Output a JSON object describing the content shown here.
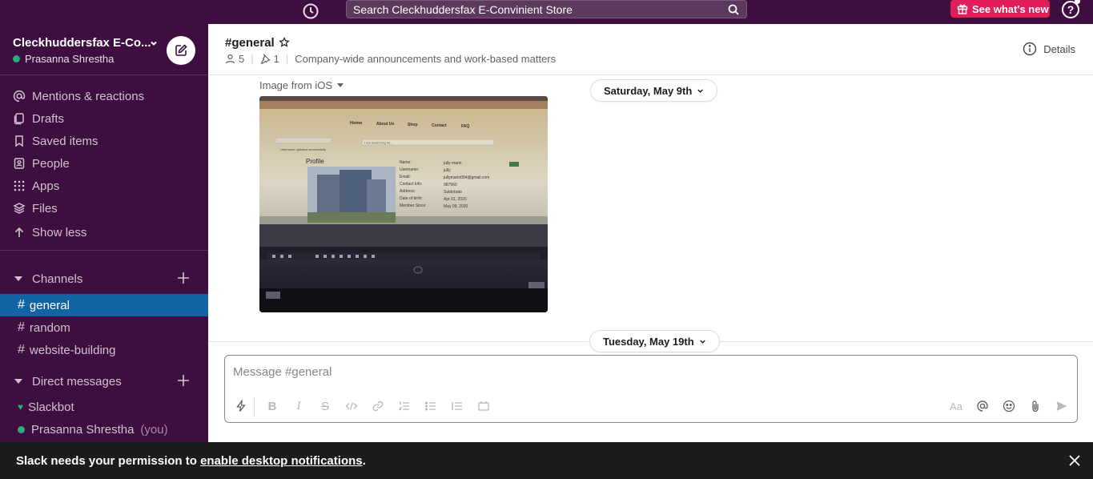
{
  "topbar": {
    "search_text": "Search Cleckhuddersfax E-Convinient Store",
    "whats_new_label": "See what's new",
    "help_label": "?"
  },
  "workspace": {
    "name": "Cleckhuddersfax E-Co...",
    "user": "Prasanna Shrestha"
  },
  "nav": {
    "items": [
      {
        "label": "Mentions & reactions",
        "icon": "at-icon"
      },
      {
        "label": "Drafts",
        "icon": "drafts-icon"
      },
      {
        "label": "Saved items",
        "icon": "bookmark-icon"
      },
      {
        "label": "People",
        "icon": "people-icon"
      },
      {
        "label": "Apps",
        "icon": "apps-icon"
      },
      {
        "label": "Files",
        "icon": "files-icon"
      },
      {
        "label": "Show less",
        "icon": "arrow-up-icon"
      }
    ]
  },
  "channels": {
    "section_label": "Channels",
    "items": [
      {
        "name": "general",
        "active": true
      },
      {
        "name": "random",
        "active": false
      },
      {
        "name": "website-building",
        "active": false
      }
    ]
  },
  "dms": {
    "section_label": "Direct messages",
    "items": [
      {
        "name": "Slackbot",
        "suffix": ""
      },
      {
        "name": "Prasanna Shrestha",
        "suffix": "(you)"
      }
    ]
  },
  "channel_header": {
    "title": "#general",
    "member_count": "5",
    "pinned_count": "1",
    "topic": "Company-wide announcements and work-based matters",
    "details_label": "Details"
  },
  "messages": {
    "image_label": "Image from iOS",
    "date_1": "Saturday, May 9th",
    "date_2": "Tuesday, May 19th",
    "photo": {
      "nav_links": [
        "Home",
        "About Us",
        "Shop",
        "Contact",
        "FAQ"
      ],
      "search_placeholder": "I am Searching for...",
      "notice": "Username updated successfully",
      "profile_heading": "Profile",
      "profile_rows": [
        {
          "label": "Name:",
          "value": "jully marin"
        },
        {
          "label": "Username:",
          "value": "jully"
        },
        {
          "label": "Email:",
          "value": "jullymarin054@gmail.com"
        },
        {
          "label": "Contact Info:",
          "value": "987560"
        },
        {
          "label": "Address:",
          "value": "Satdobato"
        },
        {
          "label": "Date of birth:",
          "value": "Apr 01, 2020"
        },
        {
          "label": "Member Since:",
          "value": "May 09, 2020"
        }
      ]
    }
  },
  "composer": {
    "placeholder": "Message #general",
    "format_aa": "Aa"
  },
  "notification": {
    "prefix": "Slack needs your permission to ",
    "link_text": "enable desktop notifications",
    "suffix": "."
  },
  "colors": {
    "sidebar": "#3f0e40",
    "active_channel": "#1164a3",
    "badge": "#e01e5a",
    "presence": "#2bac76"
  }
}
